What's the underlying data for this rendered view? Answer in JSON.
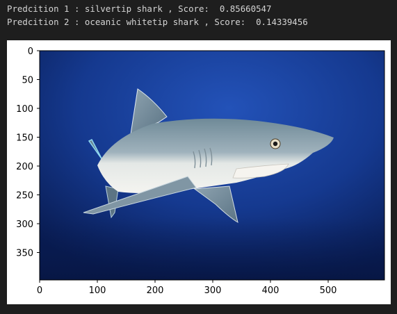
{
  "output": {
    "prediction_1": "Predcition 1 : silvertip shark , Score:  0.85660547",
    "prediction_2": "Predcition 2 : oceanic whitetip shark , Score:  0.14339456"
  },
  "figure": {
    "image_subject": "shark-photo",
    "y_ticks": [
      "0",
      "50",
      "100",
      "150",
      "200",
      "250",
      "300",
      "350"
    ],
    "x_ticks": [
      "0",
      "100",
      "200",
      "300",
      "400",
      "500"
    ],
    "colors": {
      "background": "#1e1e1e",
      "text": "#d4d4d4",
      "figure_bg": "#ffffff",
      "ocean_light": "#1d47a8",
      "ocean_dark": "#0a1f5a"
    }
  }
}
